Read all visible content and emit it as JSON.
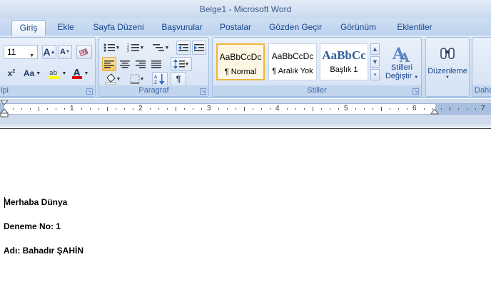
{
  "window": {
    "title": "Belge1 - Microsoft Word"
  },
  "tabs": [
    "Giriş",
    "Ekle",
    "Sayfa Düzeni",
    "Başvurular",
    "Postalar",
    "Gözden Geçir",
    "Görünüm",
    "Eklentiler"
  ],
  "active_tab": "Giriş",
  "font_group": {
    "label": "Yazı Tipi",
    "label_visible": "ipi",
    "font_size": "11",
    "grow_font": "A",
    "shrink_font": "A",
    "change_case": "Aa"
  },
  "paragraph_group": {
    "label": "Paragraf",
    "show_marks": "¶"
  },
  "styles_group": {
    "label": "Stiller",
    "styles": [
      {
        "sample": "AaBbCcDc",
        "name": "¶ Normal"
      },
      {
        "sample": "AaBbCcDc",
        "name": "¶ Aralık Yok"
      },
      {
        "sample": "AaBbCc",
        "name": "Başlık 1"
      }
    ],
    "change_styles_line1": "Stilleri",
    "change_styles_line2": "Değiştir"
  },
  "editing_group": {
    "label": "Düzenleme",
    "label_visible": "Daha"
  },
  "ruler": {
    "numbers": [
      "1",
      "2",
      "3",
      "4",
      "5",
      "6",
      "7"
    ]
  },
  "document": {
    "lines": [
      "Merhaba Dünya",
      "Deneme No: 1",
      "Adı: Bahadır ŞAHİN"
    ]
  },
  "colors": {
    "accent": "#15428b",
    "highlight": "#ffff00",
    "font_color": "#e00000",
    "selected_style_border": "#f0b53a"
  }
}
